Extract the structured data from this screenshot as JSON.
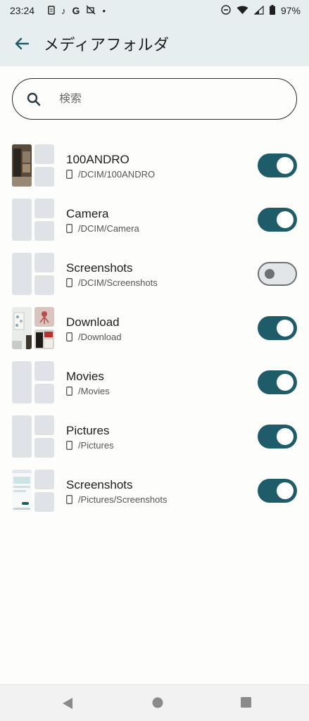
{
  "status_bar": {
    "time": "23:24",
    "battery": "97%",
    "icons": [
      "notification-icon",
      "music-note-icon",
      "google-icon",
      "no-signal-icon",
      "dot-icon",
      "dnd-icon",
      "wifi-icon",
      "cell-signal-icon",
      "battery-icon"
    ]
  },
  "app_bar": {
    "title": "メディアフォルダ",
    "back_icon": "arrow-left-icon"
  },
  "search": {
    "placeholder": "検索",
    "icon": "search-icon"
  },
  "folders": [
    {
      "name": "100ANDRO",
      "path": "/DCIM/100ANDRO",
      "enabled": true
    },
    {
      "name": "Camera",
      "path": "/DCIM/Camera",
      "enabled": true
    },
    {
      "name": "Screenshots",
      "path": "/DCIM/Screenshots",
      "enabled": false
    },
    {
      "name": "Download",
      "path": "/Download",
      "enabled": true
    },
    {
      "name": "Movies",
      "path": "/Movies",
      "enabled": true
    },
    {
      "name": "Pictures",
      "path": "/Pictures",
      "enabled": true
    },
    {
      "name": "Screenshots",
      "path": "/Pictures/Screenshots",
      "enabled": true
    }
  ],
  "colors": {
    "accent": "#1f5c6a",
    "app_bar_bg": "#e7eef0",
    "placeholder_thumb": "#dfe3e7"
  },
  "nav_bar": {
    "icons": [
      "back-triangle-icon",
      "home-circle-icon",
      "recents-square-icon"
    ]
  }
}
